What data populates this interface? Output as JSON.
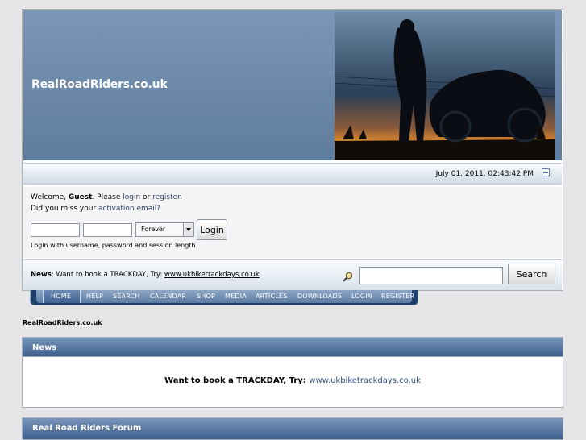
{
  "header": {
    "site_title": "RealRoadRiders.co.uk",
    "date": "July 01, 2011, 02:43:42 PM"
  },
  "user": {
    "welcome_prefix": "Welcome, ",
    "guest": "Guest",
    "please": ". Please ",
    "login": "login",
    "or": " or ",
    "register": "register",
    "period": ".",
    "missed_prefix": "Did you miss your ",
    "activation": "activation email?",
    "username_value": "",
    "password_value": "",
    "session_length": "Forever",
    "login_button": "Login",
    "hint": "Login with username, password and session length"
  },
  "news_bar": {
    "label": "News",
    "text": ": Want to book a TRACKDAY, Try: ",
    "link": "www.ukbiketrackdays.co.uk"
  },
  "search": {
    "value": "",
    "button": "Search"
  },
  "menu": [
    "HOME",
    "HELP",
    "SEARCH",
    "CALENDAR",
    "SHOP",
    "MEDIA",
    "ARTICLES",
    "DOWNLOADS",
    "LOGIN",
    "REGISTER"
  ],
  "breadcrumb": "RealRoadRiders.co.uk",
  "news_box": {
    "title": "News",
    "text": "Want to book a TRACKDAY, Try: ",
    "link": "www.ukbiketrackdays.co.uk"
  },
  "forum_box": {
    "title": "Real Road Riders Forum"
  },
  "colors": {
    "header_blue": "#6b88a9",
    "menu_dark": "#1e3f6b",
    "link": "#334466"
  },
  "icons": [
    "collapse-icon",
    "search-icon",
    "dropdown-arrow-icon"
  ]
}
